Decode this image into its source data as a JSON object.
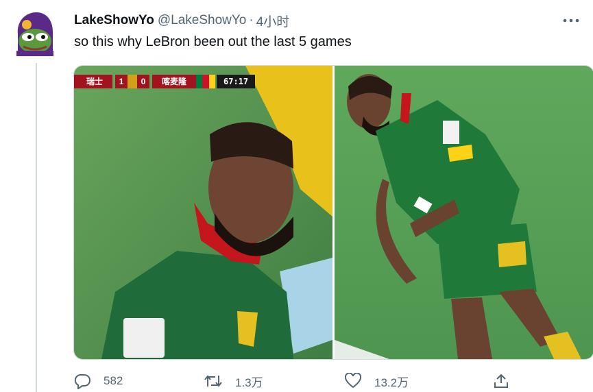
{
  "tweet": {
    "display_name": "LakeShowYo",
    "handle": "@LakeShowYo",
    "separator": "·",
    "time": "4小时",
    "text": "so this why LeBron been out the last 5 games"
  },
  "scoreboard": {
    "home_team": "瑞士",
    "home_score": "1",
    "away_score": "0",
    "away_team": "喀麦隆",
    "clock": "67:17"
  },
  "actions": {
    "reply_count": "582",
    "retweet_count": "1.3万",
    "like_count": "13.2万"
  },
  "icons": {
    "avatar": "pepe-avatar-icon",
    "more": "more-icon",
    "reply": "reply-icon",
    "retweet": "retweet-icon",
    "like": "heart-icon",
    "share": "share-icon"
  },
  "colors": {
    "secondary_text": "#536471",
    "jersey_green": "#1f7a3a",
    "pitch_green": "#5aa05a"
  }
}
